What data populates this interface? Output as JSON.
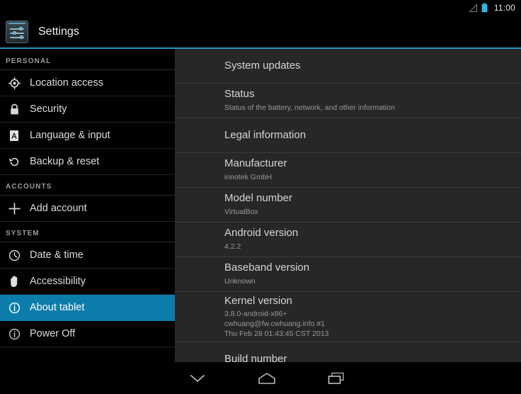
{
  "status_bar": {
    "time": "11:00",
    "icons": [
      "signal-triangle-icon",
      "battery-icon"
    ],
    "battery_color": "#33b5e5"
  },
  "action_bar": {
    "app_icon": "settings-sliders-icon",
    "title": "Settings",
    "accent_color": "#2196c4"
  },
  "sidebar": {
    "background": "#000000",
    "selected_color": "#0c7cab",
    "groups": [
      {
        "header": "PERSONAL",
        "items": [
          {
            "label": "Location access",
            "icon": "location-crosshair-icon",
            "selected": false
          },
          {
            "label": "Security",
            "icon": "lock-icon",
            "selected": false
          },
          {
            "label": "Language & input",
            "icon": "letter-a-box-icon",
            "selected": false
          },
          {
            "label": "Backup & reset",
            "icon": "restore-circle-arrow-icon",
            "selected": false
          }
        ]
      },
      {
        "header": "ACCOUNTS",
        "items": [
          {
            "label": "Add account",
            "icon": "plus-icon",
            "selected": false
          }
        ]
      },
      {
        "header": "SYSTEM",
        "items": [
          {
            "label": "Date & time",
            "icon": "clock-icon",
            "selected": false
          },
          {
            "label": "Accessibility",
            "icon": "hand-icon",
            "selected": false
          },
          {
            "label": "About tablet",
            "icon": "info-circle-icon",
            "selected": true
          },
          {
            "label": "Power Off",
            "icon": "power-info-circle-icon",
            "selected": false
          }
        ]
      }
    ]
  },
  "main": {
    "background": "#272727",
    "rows": [
      {
        "title": "System updates",
        "sub": ""
      },
      {
        "title": "Status",
        "sub": "Status of the battery, network, and other information"
      },
      {
        "title": "Legal information",
        "sub": ""
      },
      {
        "title": "Manufacturer",
        "sub": "innotek GmbH"
      },
      {
        "title": "Model number",
        "sub": "VirtualBox"
      },
      {
        "title": "Android version",
        "sub": "4.2.2"
      },
      {
        "title": "Baseband version",
        "sub": "Unknown"
      },
      {
        "title": "Kernel version",
        "sub": "3.8.0-android-x86+\ncwhuang@fw.cwhuang.info #1\nThu Feb 28 01:43:45 CST 2013"
      },
      {
        "title": "Build number",
        "sub": ""
      }
    ]
  },
  "nav_bar": {
    "buttons": [
      {
        "name": "back",
        "icon": "chevron-down-icon"
      },
      {
        "name": "home",
        "icon": "home-icon"
      },
      {
        "name": "recents",
        "icon": "recents-stacked-rectangles-icon"
      }
    ]
  }
}
